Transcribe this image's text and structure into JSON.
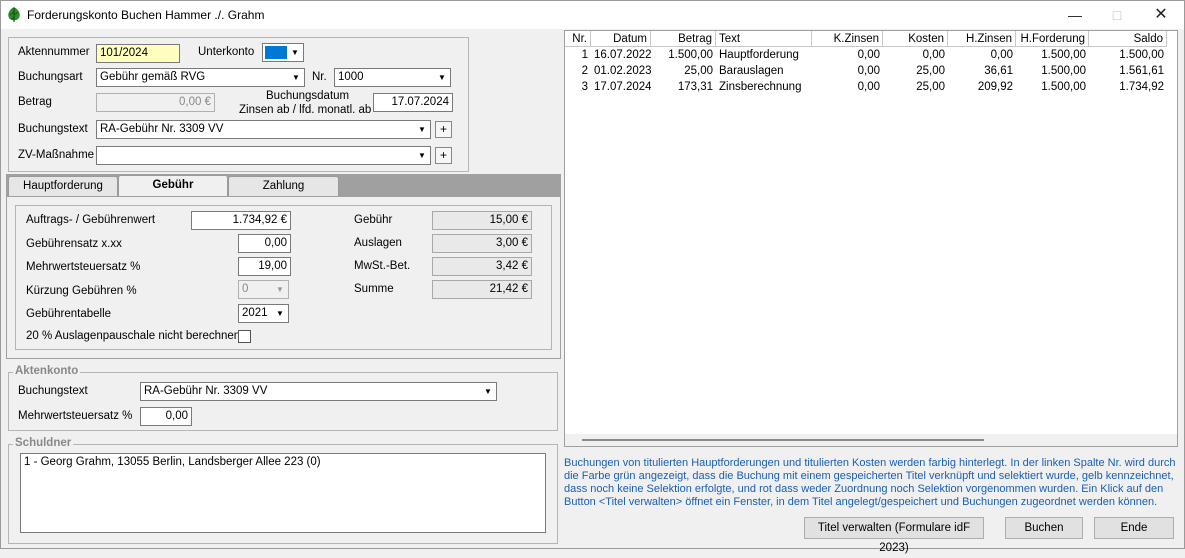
{
  "window": {
    "title": "Forderungskonto Buchen Hammer ./. Grahm"
  },
  "header_form": {
    "aktennummer_label": "Aktennummer",
    "aktennummer_value": "101/2024",
    "unterkonto_label": "Unterkonto",
    "buchungsart_label": "Buchungsart",
    "buchungsart_value": "Gebühr gemäß RVG",
    "nr_label": "Nr.",
    "nr_value": "1000",
    "betrag_label": "Betrag",
    "betrag_value": "0,00 €",
    "buchungsdatum_label": "Buchungsdatum",
    "zinsen_label": "Zinsen ab / lfd. monatl. ab",
    "datum_value": "17.07.2024",
    "buchungstext_label": "Buchungstext",
    "buchungstext_value": "RA-Gebühr Nr. 3309 VV",
    "zv_label": "ZV-Maßnahme",
    "zv_value": "",
    "plus": "+"
  },
  "tabs": [
    {
      "label": "Hauptforderung",
      "active": false
    },
    {
      "label": "Gebühr",
      "active": true
    },
    {
      "label": "Zahlung",
      "active": false
    }
  ],
  "gebuehr": {
    "auftragswert_label": "Auftrags- / Gebührenwert",
    "auftragswert_value": "1.734,92 €",
    "satz_label": "Gebührensatz x.xx",
    "satz_value": "0,00",
    "mwst_label": "Mehrwertsteuersatz %",
    "mwst_value": "19,00",
    "kuerzung_label": "Kürzung Gebühren %",
    "kuerzung_value": "0",
    "tabelle_label": "Gebührentabelle",
    "tabelle_value": "2021",
    "pauschale_label": "20 % Auslagenpauschale nicht berechnen",
    "gebuehr_label": "Gebühr",
    "gebuehr_value": "15,00 €",
    "auslagen_label": "Auslagen",
    "auslagen_value": "3,00 €",
    "mwstbet_label": "MwSt.-Bet.",
    "mwstbet_value": "3,42 €",
    "summe_label": "Summe",
    "summe_value": "21,42 €"
  },
  "aktenkonto": {
    "legend": "Aktenkonto",
    "buchungstext_label": "Buchungstext",
    "buchungstext_value": "RA-Gebühr Nr. 3309 VV",
    "mwst_label": "Mehrwertsteuersatz %",
    "mwst_value": "0,00"
  },
  "schuldner": {
    "legend": "Schuldner",
    "items": [
      "1 - Georg Grahm, 13055 Berlin, Landsberger Allee 223 (0)"
    ]
  },
  "table": {
    "headers": [
      "Nr.",
      "Datum",
      "Betrag",
      "Text",
      "K.Zinsen",
      "Kosten",
      "H.Zinsen",
      "H.Forderung",
      "Saldo"
    ],
    "rows": [
      [
        "1",
        "16.07.2022",
        "1.500,00",
        "Hauptforderung",
        "0,00",
        "0,00",
        "0,00",
        "1.500,00",
        "1.500,00"
      ],
      [
        "2",
        "01.02.2023",
        "25,00",
        "Barauslagen",
        "0,00",
        "25,00",
        "36,61",
        "1.500,00",
        "1.561,61"
      ],
      [
        "3",
        "17.07.2024",
        "173,31",
        "Zinsberechnung",
        "0,00",
        "25,00",
        "209,92",
        "1.500,00",
        "1.734,92"
      ]
    ]
  },
  "info_text": "Buchungen von titulierten Hauptforderungen und titulierten Kosten werden farbig hinterlegt. In der linken Spalte Nr. wird durch die Farbe grün angezeigt, dass die Buchung mit einem gespeicherten Titel verknüpft und selektiert wurde, gelb kennzeichnet, dass noch keine Selektion erfolgte, und rot dass weder Zuordnung noch Selektion vorgenommen wurden. Ein Klick auf den Button <Titel verwalten> öffnet ein Fenster, in dem Titel angelegt/gespeichert und Buchungen zugeordnet werden können.",
  "buttons": {
    "titel": "Titel verwalten (Formulare idF 2023)",
    "buchen": "Buchen",
    "ende": "Ende"
  },
  "colors": {
    "accent": "#0078d7",
    "info_text": "#1a5fb4",
    "highlight": "#ffffc0"
  }
}
